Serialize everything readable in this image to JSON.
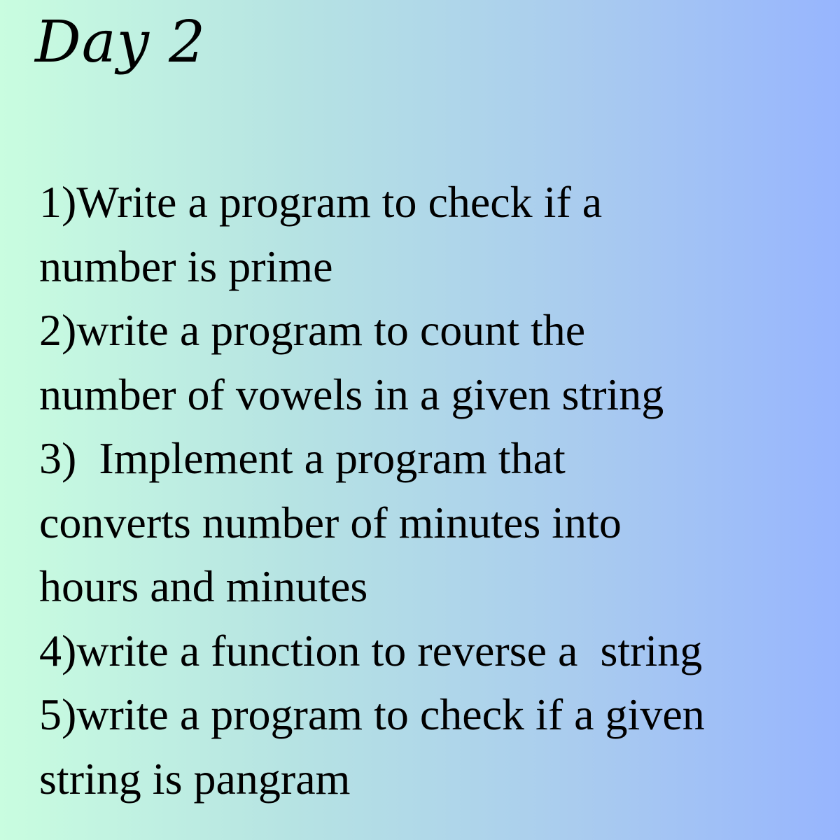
{
  "title": "Day 2",
  "tasks": [
    {
      "lines": [
        "1)Write a program to check if a",
        "number is prime"
      ]
    },
    {
      "lines": [
        "2)write a program to count the",
        "number of vowels in a given string"
      ]
    },
    {
      "lines": [
        "3)  Implement a program that",
        "converts number of minutes into",
        "hours and minutes"
      ]
    },
    {
      "lines": [
        "4)write a function to reverse a  string"
      ]
    },
    {
      "lines": [
        "5)write a program to check if a given",
        "string is pangram"
      ]
    }
  ],
  "colors": {
    "background_left": "#c9fde0",
    "background_right": "#97b5fe",
    "text": "#000000"
  }
}
